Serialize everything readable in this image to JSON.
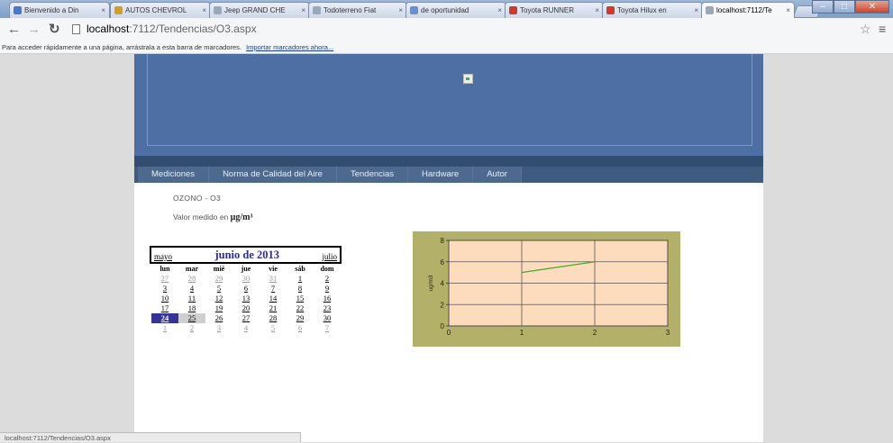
{
  "browser": {
    "tabs": [
      {
        "title": "Bienvenido a Din",
        "icon": "arrow-favicon-icon",
        "color": "#4a78c8"
      },
      {
        "title": "AUTOS CHEVROL",
        "icon": "chevrolet-favicon-icon",
        "color": "#d4a017"
      },
      {
        "title": "Jeep GRAND CHE",
        "icon": "page-favicon-icon",
        "color": "#9aa8bb"
      },
      {
        "title": "Todoterreno Fiat",
        "icon": "page-favicon-icon",
        "color": "#9aa8bb"
      },
      {
        "title": "de oportunidad",
        "icon": "olx-favicon-icon",
        "color": "#6a8fd0"
      },
      {
        "title": "Toyota RUNNER",
        "icon": "c-favicon-icon",
        "color": "#d03a2a"
      },
      {
        "title": "Toyota Hilux en",
        "icon": "c-favicon-icon",
        "color": "#d03a2a"
      },
      {
        "title": "localhost:7112/Te",
        "icon": "page-favicon-icon",
        "color": "#9aa8bb",
        "active": true
      }
    ],
    "url_host": "localhost",
    "url_path": ":7112/Tendencias/O3.aspx",
    "bookmarks_text": "Para acceder rápidamente a una página, arrástrala a esta barra de marcadores.",
    "bookmarks_link": "Importar marcadores ahora...",
    "status_text": "localhost:7112/Tendencias/O3.aspx"
  },
  "nav": {
    "items": [
      "Mediciones",
      "Norma de Calidad del Aire",
      "Tendencias",
      "Hardware",
      "Autor"
    ]
  },
  "content": {
    "title": "OZONO - O3",
    "unit_prefix": "Valor medido en ",
    "unit": "µg/m³"
  },
  "calendar": {
    "prev": "mayo",
    "month": "junio de 2013",
    "next": "julio",
    "dow": [
      "lun",
      "mar",
      "mié",
      "jue",
      "vie",
      "sáb",
      "dom"
    ],
    "weeks": [
      [
        {
          "d": "27",
          "o": 1
        },
        {
          "d": "28",
          "o": 1
        },
        {
          "d": "29",
          "o": 1
        },
        {
          "d": "30",
          "o": 1
        },
        {
          "d": "31",
          "o": 1
        },
        {
          "d": "1"
        },
        {
          "d": "2"
        }
      ],
      [
        {
          "d": "3"
        },
        {
          "d": "4"
        },
        {
          "d": "5"
        },
        {
          "d": "6"
        },
        {
          "d": "7"
        },
        {
          "d": "8"
        },
        {
          "d": "9"
        }
      ],
      [
        {
          "d": "10"
        },
        {
          "d": "11"
        },
        {
          "d": "12"
        },
        {
          "d": "13"
        },
        {
          "d": "14"
        },
        {
          "d": "15"
        },
        {
          "d": "16"
        }
      ],
      [
        {
          "d": "17"
        },
        {
          "d": "18"
        },
        {
          "d": "19"
        },
        {
          "d": "20"
        },
        {
          "d": "21"
        },
        {
          "d": "22"
        },
        {
          "d": "23"
        }
      ],
      [
        {
          "d": "24",
          "s": 1
        },
        {
          "d": "25",
          "t": 1
        },
        {
          "d": "26"
        },
        {
          "d": "27"
        },
        {
          "d": "28"
        },
        {
          "d": "29"
        },
        {
          "d": "30"
        }
      ],
      [
        {
          "d": "1",
          "o": 1
        },
        {
          "d": "2",
          "o": 1
        },
        {
          "d": "3",
          "o": 1
        },
        {
          "d": "4",
          "o": 1
        },
        {
          "d": "5",
          "o": 1
        },
        {
          "d": "6",
          "o": 1
        },
        {
          "d": "7",
          "o": 1
        }
      ]
    ]
  },
  "chart_data": {
    "type": "line",
    "ylabel": "ug/m3",
    "xlim": [
      0,
      3
    ],
    "ylim": [
      0,
      8
    ],
    "xticks": [
      "0",
      "1",
      "2",
      "3"
    ],
    "yticks": [
      "0",
      "2",
      "4",
      "6",
      "8"
    ],
    "grid": true,
    "plot_bg": "#fcdcbc",
    "frame_bg": "#b3b069",
    "series": [
      {
        "x": [
          1,
          2
        ],
        "y": [
          5,
          6
        ],
        "color": "#44aa22"
      }
    ]
  }
}
